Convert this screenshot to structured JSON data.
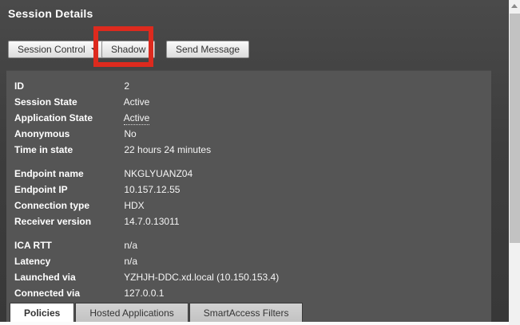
{
  "title": "Session Details",
  "toolbar": {
    "session_control_label": "Session Control",
    "shadow_label": "Shadow",
    "send_message_label": "Send Message"
  },
  "annotation": {
    "highlight_color": "#dd2a1e",
    "highlighted_button": "Shadow"
  },
  "details": {
    "groups": [
      {
        "rows": [
          {
            "label": "ID",
            "value": "2"
          },
          {
            "label": "Session State",
            "value": "Active"
          },
          {
            "label": "Application State",
            "value": "Active"
          },
          {
            "label": "Anonymous",
            "value": "No"
          },
          {
            "label": "Time in state",
            "value": "22 hours 24 minutes"
          }
        ]
      },
      {
        "rows": [
          {
            "label": "Endpoint name",
            "value": "NKGLYUANZ04"
          },
          {
            "label": "Endpoint IP",
            "value": "10.157.12.55"
          },
          {
            "label": "Connection type",
            "value": "HDX"
          },
          {
            "label": "Receiver version",
            "value": "14.7.0.13011"
          }
        ]
      },
      {
        "rows": [
          {
            "label": "ICA RTT",
            "value": "n/a"
          },
          {
            "label": "Latency",
            "value": "n/a"
          },
          {
            "label": "Launched via",
            "value": "YZHJH-DDC.xd.local (10.150.153.4)"
          },
          {
            "label": "Connected via",
            "value": "127.0.0.1"
          }
        ]
      }
    ]
  },
  "tabs": [
    {
      "label": "Policies",
      "active": true
    },
    {
      "label": "Hosted Applications",
      "active": false
    },
    {
      "label": "SmartAccess Filters",
      "active": false
    }
  ],
  "colors": {
    "page_background": "#3d3d3d",
    "panel_background": "#555555",
    "annotation_red": "#dd2a1e",
    "active_tab_background": "#ffffff",
    "scrollbar_thumb": "#c2c2c2"
  }
}
